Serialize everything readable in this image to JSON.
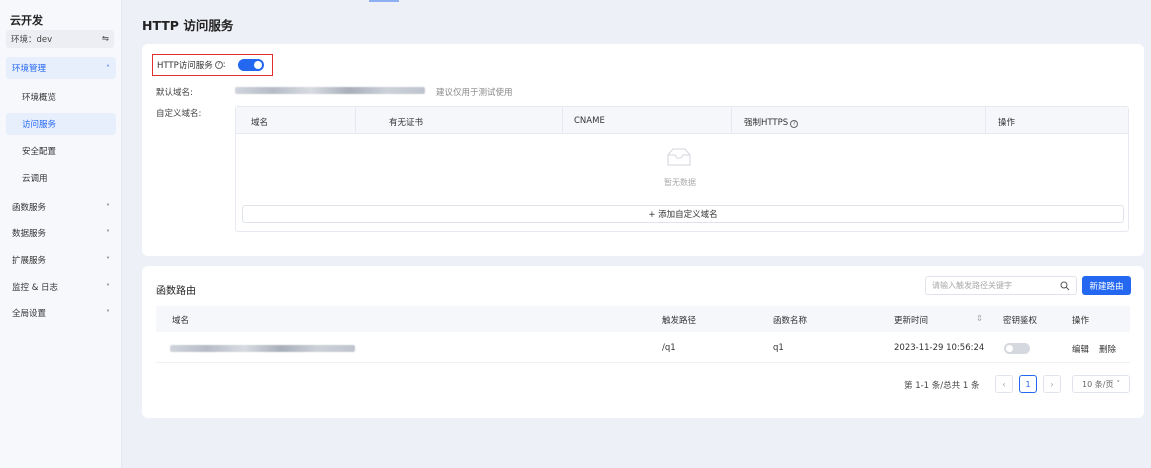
{
  "sidebar": {
    "brand": "云开发",
    "env_label": "环境：dev",
    "groups": [
      {
        "label": "环境管理"
      },
      {
        "label": "函数服务"
      },
      {
        "label": "数据服务"
      },
      {
        "label": "扩展服务"
      },
      {
        "label": "监控 & 日志"
      },
      {
        "label": "全局设置"
      }
    ],
    "sub_items": [
      {
        "label": "环境概览"
      },
      {
        "label": "访问服务"
      },
      {
        "label": "安全配置"
      },
      {
        "label": "云调用"
      }
    ]
  },
  "page": {
    "title": "HTTP 访问服务"
  },
  "http_service": {
    "toggle_label": "HTTP访问服务",
    "toggle_on": true,
    "default_domain_label": "默认域名:",
    "default_domain_hint": "建议仅用于测试使用",
    "custom_domain_label": "自定义域名:",
    "table_headers": [
      "域名",
      "有无证书",
      "CNAME",
      "强制HTTPS",
      "操作"
    ],
    "empty_text": "暂无数据",
    "add_button": "+ 添加自定义域名"
  },
  "routes": {
    "title": "函数路由",
    "search_placeholder": "请输入触发路径关键字",
    "new_button": "新建路由",
    "headers": [
      "域名",
      "触发路径",
      "函数名称",
      "更新时间",
      "密钥鉴权",
      "操作"
    ],
    "rows": [
      {
        "path": "/q1",
        "function": "q1",
        "updated": "2023-11-29 10:56:24",
        "auth_on": false,
        "edit": "编辑",
        "delete": "删除"
      }
    ],
    "pagination": {
      "summary": "第 1-1 条/总共 1 条",
      "current_page": "1",
      "page_size": "10 条/页"
    }
  },
  "colors": {
    "accent": "#2468f2",
    "highlight_border": "#e0302e"
  }
}
